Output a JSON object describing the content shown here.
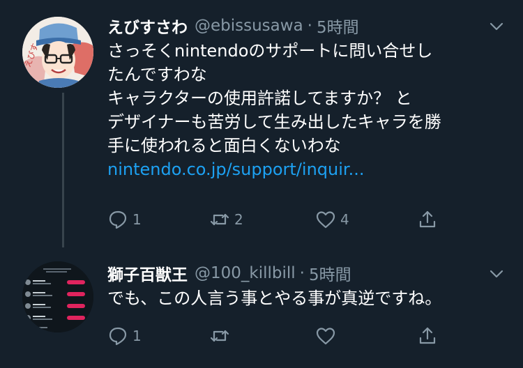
{
  "tweets": [
    {
      "name": "えびすさわ",
      "handle": "@ebissusawa",
      "time": "5時間",
      "lines": [
        "さっそくnintendoのサポートに問い合せし",
        "たんですわな",
        "キャラクターの使用許諾してますか？ と",
        "デザイナーも苦労して生み出したキャラを勝",
        "手に使われると面白くないわな"
      ],
      "link": "nintendo.co.jp/support/inquir...",
      "replies": "1",
      "retweets": "2",
      "likes": "4"
    },
    {
      "name": "獅子百獣王",
      "handle": "@100_killbill",
      "time": "5時間",
      "lines": [
        "でも、この人言う事とやる事が真逆ですね。"
      ],
      "replies": "1",
      "retweets": "",
      "likes": ""
    }
  ],
  "separator": "·",
  "colors": {
    "background": "#15202b",
    "secondary_text": "#8899a6",
    "link": "#1da1f2",
    "thread_line": "#38444d",
    "block_button": "#e0245e"
  },
  "icons": [
    "reply-icon",
    "retweet-icon",
    "like-icon",
    "share-icon",
    "chevron-down-icon"
  ]
}
